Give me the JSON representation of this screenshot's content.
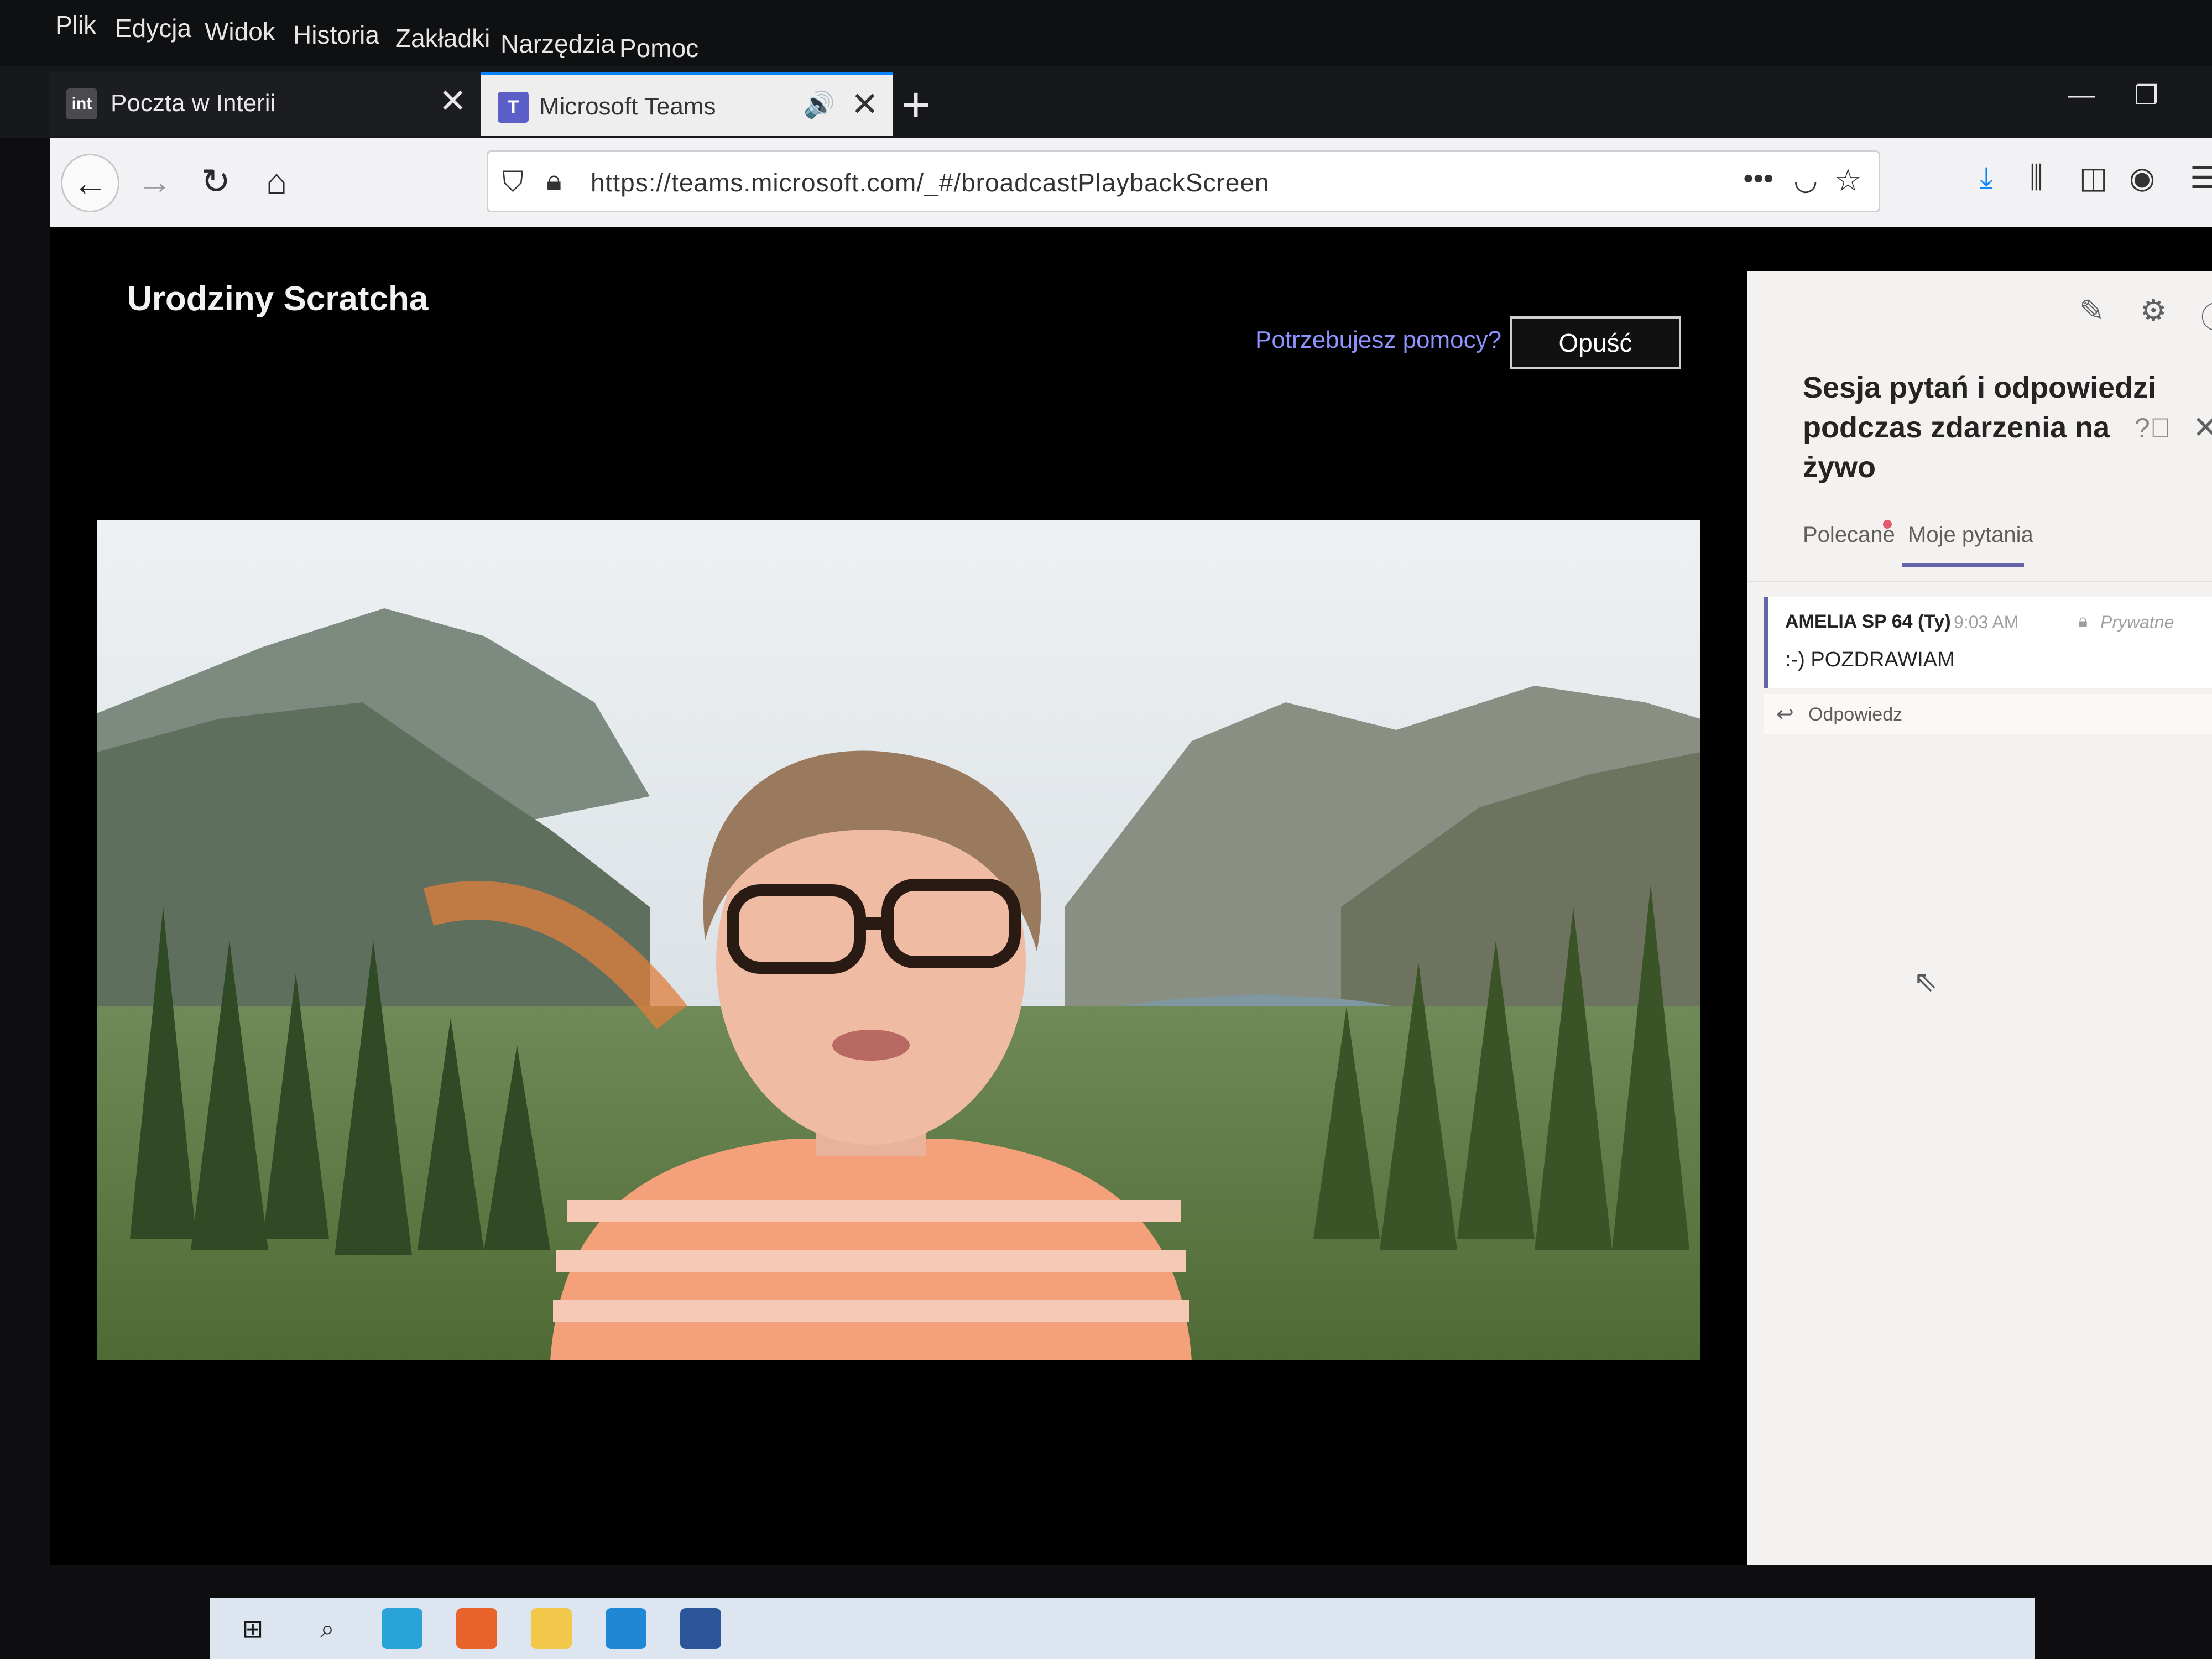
{
  "menubar": {
    "items": [
      "Plik",
      "Edycja",
      "Widok",
      "Historia",
      "Zakładki",
      "Narzędzia",
      "Pomoc"
    ]
  },
  "tabs": [
    {
      "title": "Poczta w Interii",
      "favicon": "int"
    },
    {
      "title": "Microsoft Teams",
      "favicon": "T"
    }
  ],
  "toolbar": {
    "url": "https://teams.microsoft.com/_#/broadcastPlaybackScreen",
    "overflow": "•••"
  },
  "event": {
    "title": "Urodziny Scratcha",
    "help_link": "Potrzebujesz pomocy?",
    "leave_label": "Opuść"
  },
  "qa": {
    "title": "Sesja pytań i odpowiedzi podczas zdarzenia na żywo",
    "tabs": [
      "Polecane",
      "Moje pytania"
    ],
    "active_tab": "Moje pytania",
    "questions": [
      {
        "author": "AMELIA SP 64 (Ty)",
        "time": "9:03 AM",
        "visibility": "Prywatne",
        "text": ":-) POZDRAWIAM",
        "reply_label": "Odpowiedz"
      }
    ]
  },
  "colors": {
    "teams_accent": "#6264a7",
    "firefox_accent": "#0a84ff",
    "help_link": "#8e94ff"
  },
  "icons": [
    "shield-icon",
    "lock-icon",
    "pocket-icon",
    "star-icon",
    "download-icon",
    "library-icon",
    "sidebar-icon",
    "account-icon",
    "hamburger-menu-icon",
    "qa-settings-icon",
    "qa-info-icon",
    "reply-icon"
  ]
}
